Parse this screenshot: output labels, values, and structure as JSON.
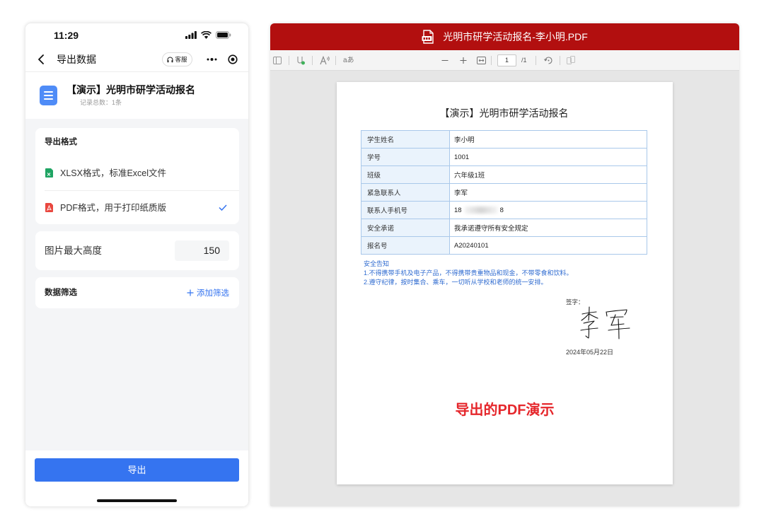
{
  "theme": {
    "accent_blue": "#3574f0",
    "title_bar_red": "#b20f0f",
    "caption_red": "#e5262b",
    "notice_blue": "#2f6bd0",
    "table_border": "#a9c8ea",
    "table_label_bg": "#eaf3fc",
    "xlsx_green": "#1fa463",
    "pdf_red": "#e9473f"
  },
  "phone": {
    "status_bar": {
      "time": "11:29",
      "icons": [
        "signal-icon",
        "wifi-icon",
        "battery-icon"
      ]
    },
    "nav": {
      "title": "导出数据",
      "service_label": "客服",
      "icons": [
        "back-icon",
        "headset-icon",
        "more-dots-icon",
        "target-icon"
      ]
    },
    "header": {
      "title": "【演示】光明市研学活动报名",
      "subtitle": "记录总数：1条",
      "icon": "form-doc-icon"
    },
    "export_format": {
      "title": "导出格式",
      "options": [
        {
          "label": "XLSX格式，标准Excel文件",
          "icon": "xlsx-file-icon",
          "selected": false
        },
        {
          "label": "PDF格式，用于打印纸质版",
          "icon": "pdf-file-icon",
          "selected": true
        }
      ]
    },
    "image_max_height": {
      "label": "图片最大高度",
      "value": "150"
    },
    "data_filter": {
      "label": "数据筛选",
      "add_label": "添加筛选",
      "add_icon": "plus-icon"
    },
    "export_button": {
      "label": "导出"
    }
  },
  "pdf_viewer": {
    "title": "光明市研学活动报名-李小明.PDF",
    "title_icon": "pdf-file-icon",
    "toolbar": {
      "translate_label": "aあ",
      "current_page": "1",
      "page_total": "/1",
      "icons": [
        "sidebar-icon",
        "draw-icon",
        "read-aloud-icon",
        "zoom-out-icon",
        "zoom-in-icon",
        "fit-page-icon",
        "rotate-icon",
        "two-page-icon"
      ]
    },
    "document": {
      "title": "【演示】光明市研学活动报名",
      "fields": [
        {
          "label": "学生姓名",
          "value": "李小明"
        },
        {
          "label": "学号",
          "value": "1001"
        },
        {
          "label": "班级",
          "value": "六年级1班"
        },
        {
          "label": "紧急联系人",
          "value": "李军"
        },
        {
          "label": "联系人手机号",
          "value_prefix": "18",
          "value_suffix": "8",
          "masked": true
        },
        {
          "label": "安全承诺",
          "value": "我承诺遵守所有安全规定"
        },
        {
          "label": "报名号",
          "value": "A20240101"
        }
      ],
      "notice": {
        "heading": "安全告知",
        "lines": [
          "1.不得携带手机及电子产品，不得携带贵重物品和现金，不带零食和饮料。",
          "2.遵守纪律，按时集合、乘车，一切听从学校和老师的统一安排。"
        ]
      },
      "signature_label": "签字：",
      "signature": "李军",
      "date": "2024年05月22日"
    },
    "caption": "导出的PDF演示"
  }
}
